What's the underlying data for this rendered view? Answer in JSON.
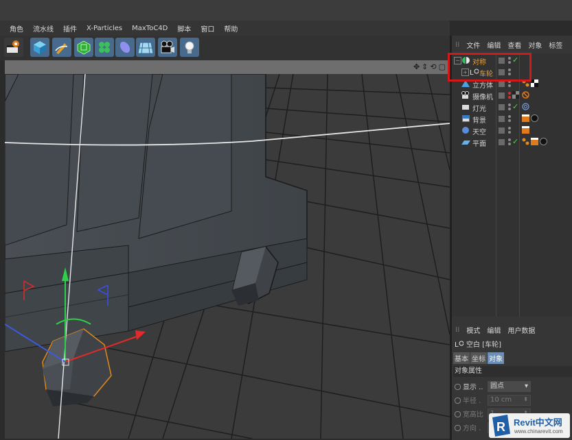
{
  "menu": [
    "角色",
    "流水线",
    "插件",
    "X-Particles",
    "MaxToC4D",
    "脚本",
    "窗口",
    "帮助"
  ],
  "toolbar": {
    "buttons": [
      {
        "name": "render-view-icon"
      },
      {
        "name": "cube-icon"
      },
      {
        "name": "pen-icon"
      },
      {
        "name": "subdivision-icon"
      },
      {
        "name": "cloner-icon"
      },
      {
        "name": "deformer-icon"
      },
      {
        "name": "floor-icon"
      },
      {
        "name": "camera-icon"
      },
      {
        "name": "light-icon"
      }
    ]
  },
  "viewport": {
    "nav_icons": [
      "✥",
      "⇕",
      "⟲",
      "▢"
    ]
  },
  "object_manager": {
    "menu": [
      "文件",
      "编辑",
      "查看",
      "对象",
      "标签"
    ],
    "objects": [
      {
        "label": "对称",
        "icon": "symmetry-icon",
        "highlighted": true,
        "color": "#e6a040"
      },
      {
        "label": "车轮",
        "icon": "null-icon",
        "highlighted": true,
        "color": "#e6a040"
      },
      {
        "label": "立方体",
        "icon": "cube-object-icon",
        "color": "#d0d0d0"
      },
      {
        "label": "摄像机",
        "icon": "camera-object-icon",
        "color": "#d0d0d0"
      },
      {
        "label": "灯光",
        "icon": "light-object-icon",
        "color": "#d0d0d0"
      },
      {
        "label": "背景",
        "icon": "background-object-icon",
        "color": "#d0d0d0"
      },
      {
        "label": "天空",
        "icon": "sky-object-icon",
        "color": "#d0d0d0"
      },
      {
        "label": "平面",
        "icon": "plane-object-icon",
        "color": "#d0d0d0"
      }
    ]
  },
  "attribute_manager": {
    "menu": [
      "模式",
      "编辑",
      "用户数据"
    ],
    "title": "空白 [车轮]",
    "tabs": [
      "基本",
      "坐标",
      "对象"
    ],
    "active_tab": "对象",
    "section": "对象属性",
    "props": [
      {
        "label": "显示 ..",
        "value": "圆点",
        "dim": false
      },
      {
        "label": "半径 .",
        "value": "10 cm",
        "dim": true
      },
      {
        "label": "宽高比",
        "value": "1",
        "dim": true
      },
      {
        "label": "方向 .",
        "value": "",
        "dim": true
      }
    ]
  },
  "watermark": {
    "brand": "Revit中文网",
    "url": "www.chinarevit.com"
  },
  "colors": {
    "highlight_border": "#d21919",
    "selected_object_text": "#e6a040",
    "check_green": "#55d24b"
  }
}
